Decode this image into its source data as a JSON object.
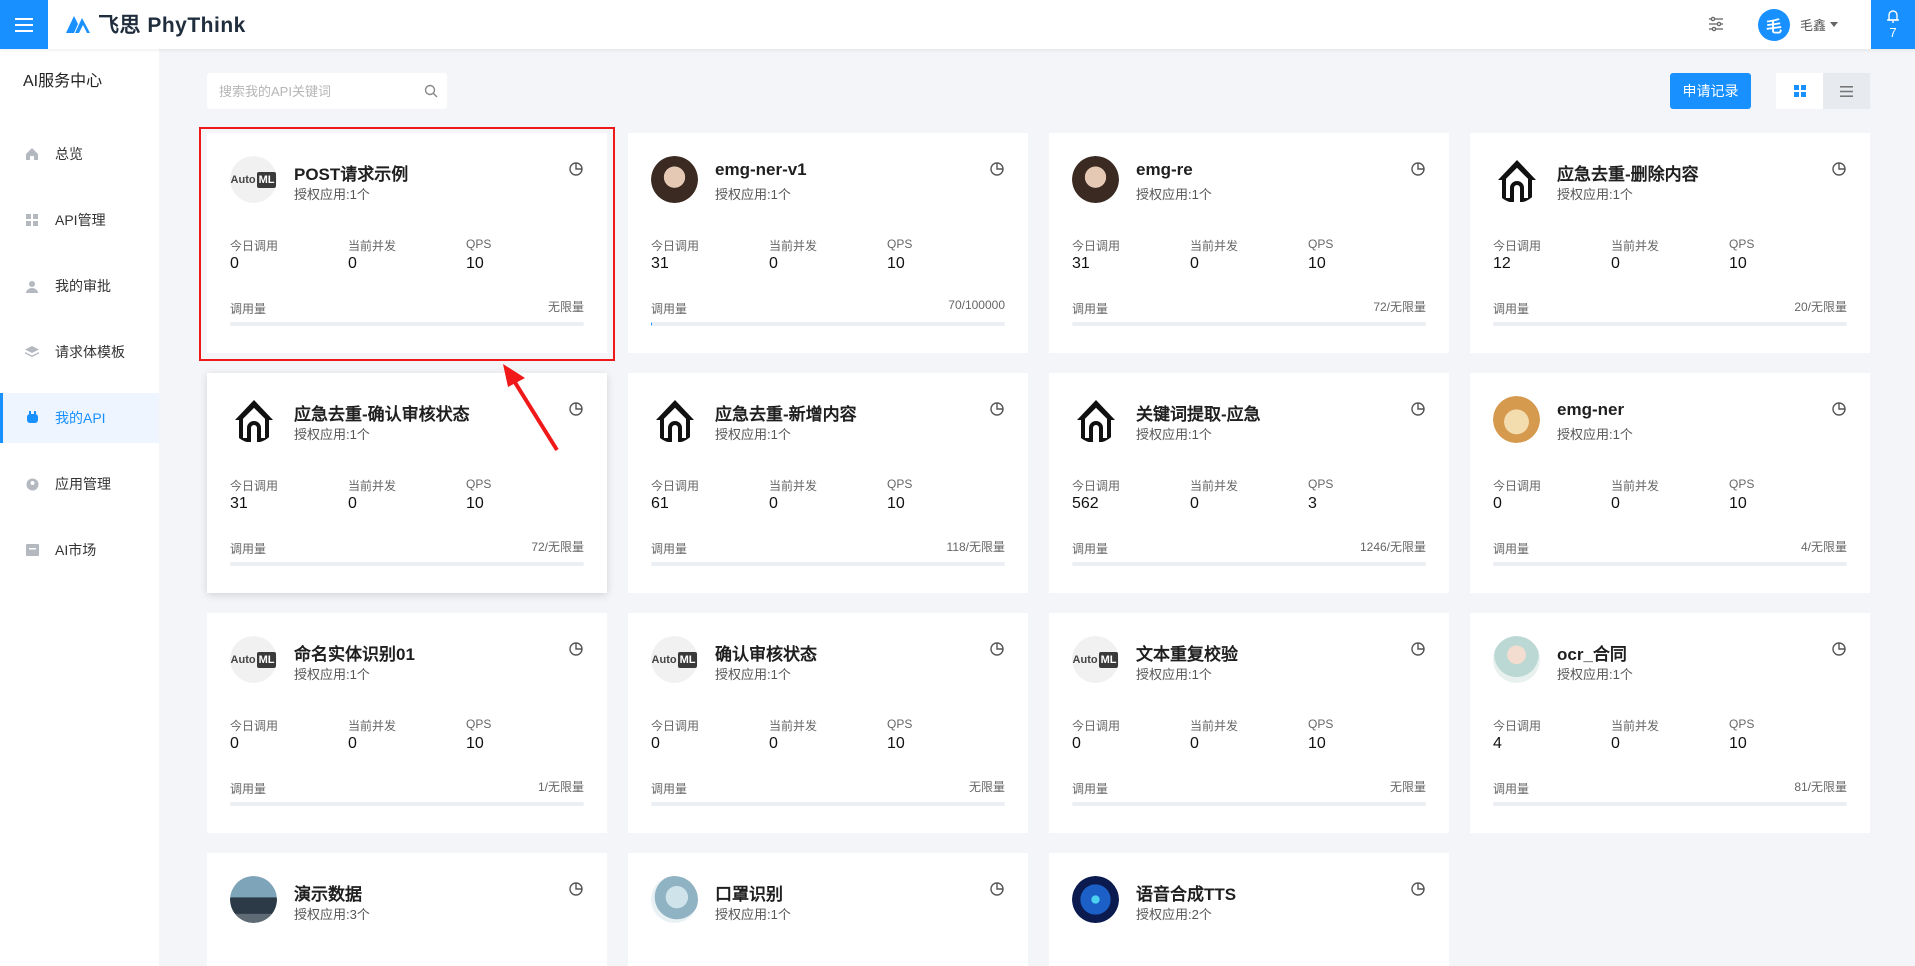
{
  "brand": {
    "name": "飞思 PhyThink",
    "accent": "#1890ff"
  },
  "header": {
    "user_avatar_char": "毛",
    "username": "毛鑫",
    "notification_count": "7"
  },
  "sidebar": {
    "title": "AI服务中心",
    "items": [
      {
        "label": "总览",
        "icon": "home-icon"
      },
      {
        "label": "API管理",
        "icon": "grid-icon"
      },
      {
        "label": "我的审批",
        "icon": "user-icon"
      },
      {
        "label": "请求体模板",
        "icon": "layers-icon"
      },
      {
        "label": "我的API",
        "icon": "api-icon",
        "active": true
      },
      {
        "label": "应用管理",
        "icon": "app-icon"
      },
      {
        "label": "AI市场",
        "icon": "market-icon"
      }
    ]
  },
  "toolbar": {
    "search_placeholder": "搜索我的API关键词",
    "apply_label": "申请记录"
  },
  "labels": {
    "today_calls": "今日调用",
    "concurrency": "当前并发",
    "qps": "QPS",
    "usage": "调用量"
  },
  "cards": [
    {
      "name": "POST请求示例",
      "sub": "授权应用:1个",
      "today": "0",
      "concurrency": "0",
      "qps": "10",
      "usage": "无限量",
      "progress": 0,
      "logo": "automl"
    },
    {
      "name": "emg-ner-v1",
      "sub": "授权应用:1个",
      "today": "31",
      "concurrency": "0",
      "qps": "10",
      "usage": "70/100000",
      "progress": 0.0007,
      "logo": "face"
    },
    {
      "name": "emg-re",
      "sub": "授权应用:1个",
      "today": "31",
      "concurrency": "0",
      "qps": "10",
      "usage": "72/无限量",
      "progress": 0,
      "logo": "face"
    },
    {
      "name": "应急去重-删除内容",
      "sub": "授权应用:1个",
      "today": "12",
      "concurrency": "0",
      "qps": "10",
      "usage": "20/无限量",
      "progress": 0,
      "logo": "house"
    },
    {
      "name": "应急去重-确认审核状态",
      "sub": "授权应用:1个",
      "today": "31",
      "concurrency": "0",
      "qps": "10",
      "usage": "72/无限量",
      "progress": 0,
      "logo": "house"
    },
    {
      "name": "应急去重-新增内容",
      "sub": "授权应用:1个",
      "today": "61",
      "concurrency": "0",
      "qps": "10",
      "usage": "118/无限量",
      "progress": 0,
      "logo": "house"
    },
    {
      "name": "关键词提取-应急",
      "sub": "授权应用:1个",
      "today": "562",
      "concurrency": "0",
      "qps": "3",
      "usage": "1246/无限量",
      "progress": 0,
      "logo": "house"
    },
    {
      "name": "emg-ner",
      "sub": "授权应用:1个",
      "today": "0",
      "concurrency": "0",
      "qps": "10",
      "usage": "4/无限量",
      "progress": 0,
      "logo": "dog"
    },
    {
      "name": "命名实体识别01",
      "sub": "授权应用:1个",
      "today": "0",
      "concurrency": "0",
      "qps": "10",
      "usage": "1/无限量",
      "progress": 0,
      "logo": "automl"
    },
    {
      "name": "确认审核状态",
      "sub": "授权应用:1个",
      "today": "0",
      "concurrency": "0",
      "qps": "10",
      "usage": "无限量",
      "progress": 0,
      "logo": "automl"
    },
    {
      "name": "文本重复校验",
      "sub": "授权应用:1个",
      "today": "0",
      "concurrency": "0",
      "qps": "10",
      "usage": "无限量",
      "progress": 0,
      "logo": "automl"
    },
    {
      "name": "ocr_合同",
      "sub": "授权应用:1个",
      "today": "4",
      "concurrency": "0",
      "qps": "10",
      "usage": "81/无限量",
      "progress": 0,
      "logo": "woman"
    },
    {
      "name": "演示数据",
      "sub": "授权应用:3个",
      "logo": "car",
      "partial": true
    },
    {
      "name": "口罩识别",
      "sub": "授权应用:1个",
      "logo": "doctor",
      "partial": true
    },
    {
      "name": "语音合成TTS",
      "sub": "授权应用:2个",
      "logo": "tts",
      "partial": true
    }
  ]
}
